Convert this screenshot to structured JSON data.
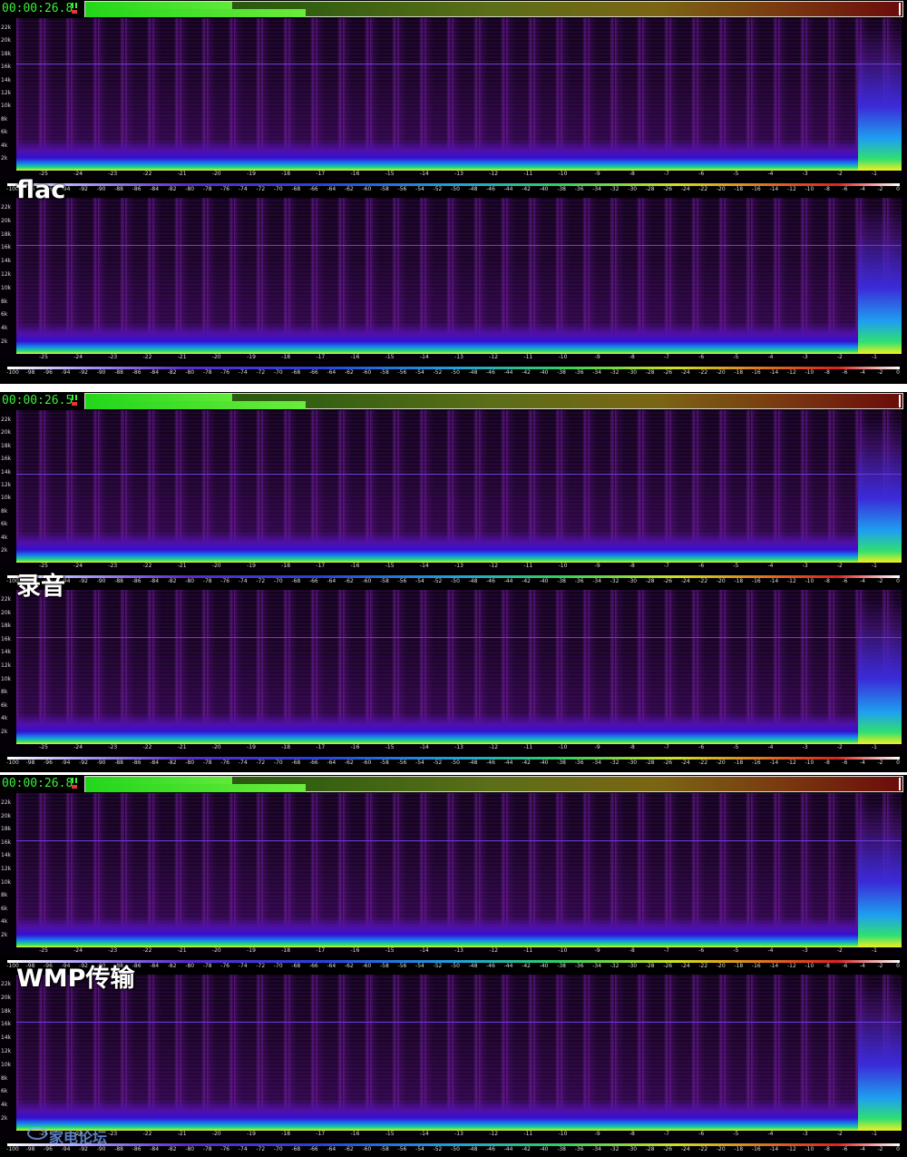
{
  "groups": [
    {
      "time": "00:00:26.8",
      "caption": "flac",
      "meter": {
        "peak_fraction": 0.18,
        "level_fraction": 0.27
      }
    },
    {
      "time": "00:00:26.5",
      "caption": "录音",
      "meter": {
        "peak_fraction": 0.18,
        "level_fraction": 0.27
      }
    },
    {
      "time": "00:00:26.8",
      "caption": "WMP传输",
      "meter": {
        "peak_fraction": 0.18,
        "level_fraction": 0.27
      }
    }
  ],
  "frequency_axis": [
    "22k",
    "20k",
    "18k",
    "16k",
    "14k",
    "12k",
    "10k",
    "8k",
    "6k",
    "4k",
    "2k"
  ],
  "time_axis": [
    "-25",
    "-24",
    "-23",
    "-22",
    "-21",
    "-20",
    "-19",
    "-18",
    "-17",
    "-16",
    "-15",
    "-14",
    "-13",
    "-12",
    "-11",
    "-10",
    "-9",
    "-8",
    "-7",
    "-6",
    "-5",
    "-4",
    "-3",
    "-2",
    "-1"
  ],
  "db_scale": [
    "-100",
    "-98",
    "-96",
    "-94",
    "-92",
    "-90",
    "-88",
    "-86",
    "-84",
    "-82",
    "-80",
    "-78",
    "-76",
    "-74",
    "-72",
    "-70",
    "-68",
    "-66",
    "-64",
    "-62",
    "-60",
    "-58",
    "-56",
    "-54",
    "-52",
    "-50",
    "-48",
    "-46",
    "-44",
    "-42",
    "-40",
    "-38",
    "-36",
    "-34",
    "-32",
    "-30",
    "-28",
    "-26",
    "-24",
    "-22",
    "-20",
    "-18",
    "-16",
    "-14",
    "-12",
    "-10",
    "-8",
    "-6",
    "-4",
    "-2",
    "0"
  ],
  "watermark": "家电论坛",
  "colors": {
    "time_text": "#3cf03c",
    "cutoff_line": "#6a3bd8"
  }
}
